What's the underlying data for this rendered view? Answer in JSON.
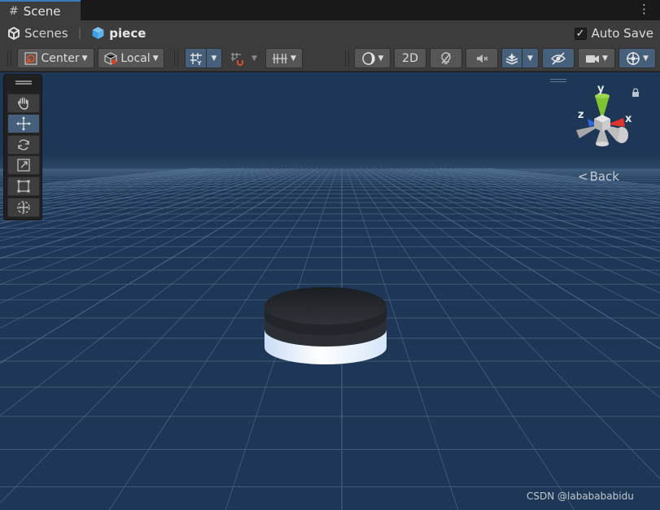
{
  "tab": {
    "label": "Scene",
    "icon": "grid-hash-icon"
  },
  "breadcrumb": {
    "scenes_label": "Scenes",
    "piece_label": "piece"
  },
  "autosave": {
    "label": "Auto Save",
    "checked": true
  },
  "toolbar": {
    "pivot_label": "Center",
    "rotation_label": "Local",
    "mode_2d_label": "2D"
  },
  "gizmo": {
    "axis_y": "y",
    "axis_x": "x",
    "axis_z": "z",
    "view_label": "Back"
  },
  "colors": {
    "scene_sky": "#1e3756",
    "active_button": "#46607c",
    "axis_x": "#e0352a",
    "axis_y": "#7fc232",
    "axis_z": "#2f66d8"
  },
  "watermark": "CSDN @lababababidu"
}
